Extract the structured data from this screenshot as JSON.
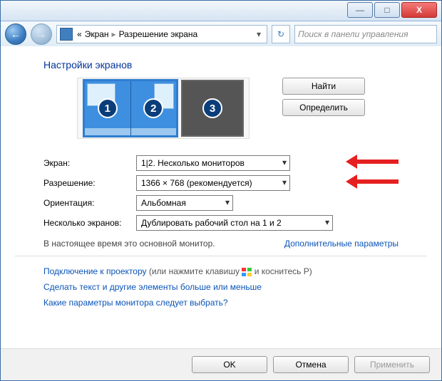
{
  "window_buttons": {
    "min": "—",
    "max": "□",
    "close": "X"
  },
  "nav": {
    "back": "←",
    "forward": "→",
    "refresh": "↻"
  },
  "breadcrumb": {
    "root": "«",
    "item1": "Экран",
    "item2": "Разрешение экрана"
  },
  "search": {
    "placeholder": "Поиск в панели управления"
  },
  "heading": "Настройки экранов",
  "monitors": {
    "m1": "1",
    "m2": "2",
    "m3": "3"
  },
  "buttons": {
    "find": "Найти",
    "identify": "Определить"
  },
  "labels": {
    "display": "Экран:",
    "resolution": "Разрешение:",
    "orientation": "Ориентация:",
    "multiple": "Несколько экранов:"
  },
  "selects": {
    "display": "1|2. Несколько мониторов",
    "resolution": "1366 × 768 (рекомендуется)",
    "orientation": "Альбомная",
    "multiple": "Дублировать рабочий стол на 1 и 2"
  },
  "info": {
    "primary": "В настоящее время это основной монитор.",
    "advanced": "Дополнительные параметры"
  },
  "links": {
    "projector_a": "Подключение к проектору",
    "projector_b": "(или нажмите клавишу",
    "projector_c": "и коснитесь P)",
    "textsize": "Сделать текст и другие элементы больше или меньше",
    "whichmon": "Какие параметры монитора следует выбрать?"
  },
  "footer": {
    "ok": "OK",
    "cancel": "Отмена",
    "apply": "Применить"
  }
}
